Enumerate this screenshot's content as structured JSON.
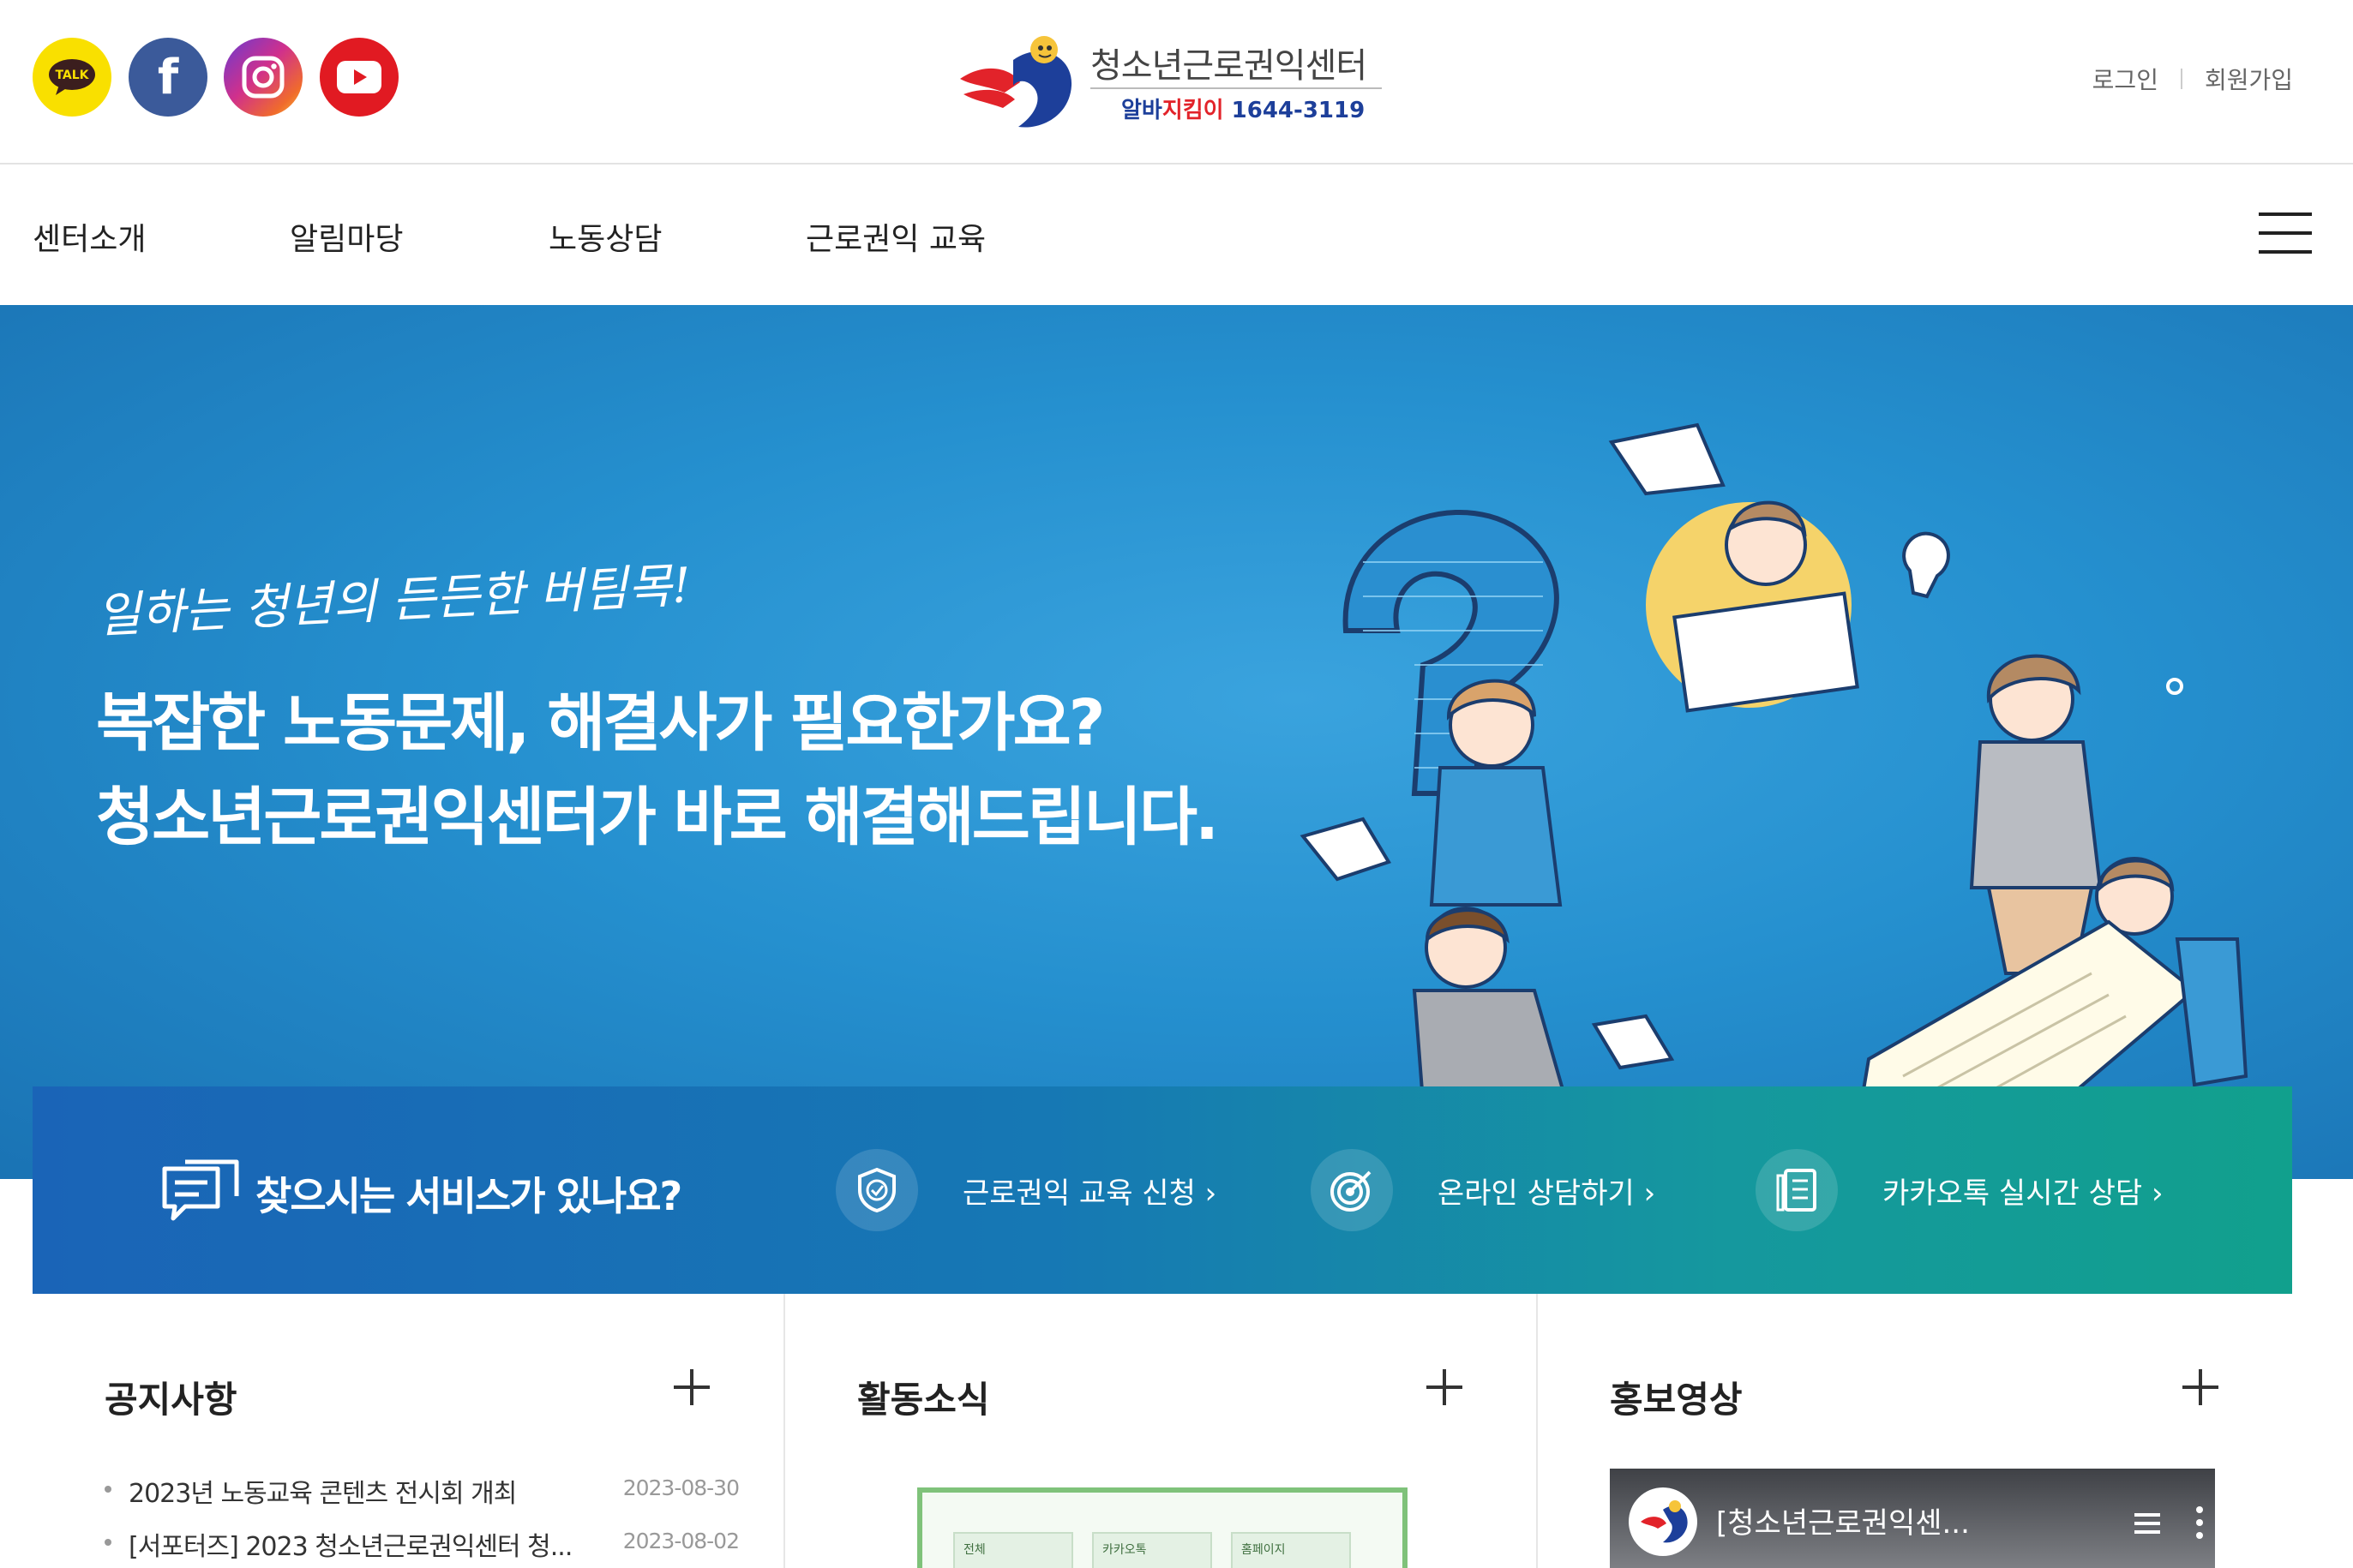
{
  "header": {
    "logo_title": "청소년근로권익센터",
    "logo_sub_part1": "알바",
    "logo_sub_part2": "지킴이",
    "logo_sub_part3": " 1644-3119",
    "login": "로그인",
    "signup": "회원가입",
    "social": [
      {
        "name": "kakao-talk-icon",
        "label": "TALK"
      },
      {
        "name": "facebook-icon",
        "label": "f"
      },
      {
        "name": "instagram-icon"
      },
      {
        "name": "youtube-icon"
      }
    ]
  },
  "nav": {
    "items": [
      "센터소개",
      "알림마당",
      "노동상담",
      "근로권익 교육"
    ]
  },
  "hero": {
    "handwriting": "일하는 청년의 든든한 버팀목!",
    "headline1": "복잡한 노동문제, 해결사가 필요한가요?",
    "headline2": "청소년근로권익센터가 바로 해결해드립니다."
  },
  "service": {
    "question": "찾으시는 서비스가 있나요?",
    "links": [
      {
        "label": "근로권익 교육 신청 ›",
        "icon": "shield-check-icon"
      },
      {
        "label": "온라인 상담하기 ›",
        "icon": "target-icon"
      },
      {
        "label": "카카오톡 실시간 상담 ›",
        "icon": "document-list-icon"
      }
    ]
  },
  "panels": {
    "notice": {
      "title": "공지사항",
      "items": [
        {
          "title": "2023년 노동교육 콘텐츠 전시회 개최",
          "date": "2023-08-30"
        },
        {
          "title": "[서포터즈] 2023 청소년근로권익센터 청...",
          "date": "2023-08-02"
        }
      ]
    },
    "activity": {
      "title": "활동소식",
      "tabs": [
        "전체",
        "카카오톡",
        "홈페이지"
      ]
    },
    "promo": {
      "title": "홍보영상",
      "video_title": "[청소년근로권익센..."
    }
  }
}
